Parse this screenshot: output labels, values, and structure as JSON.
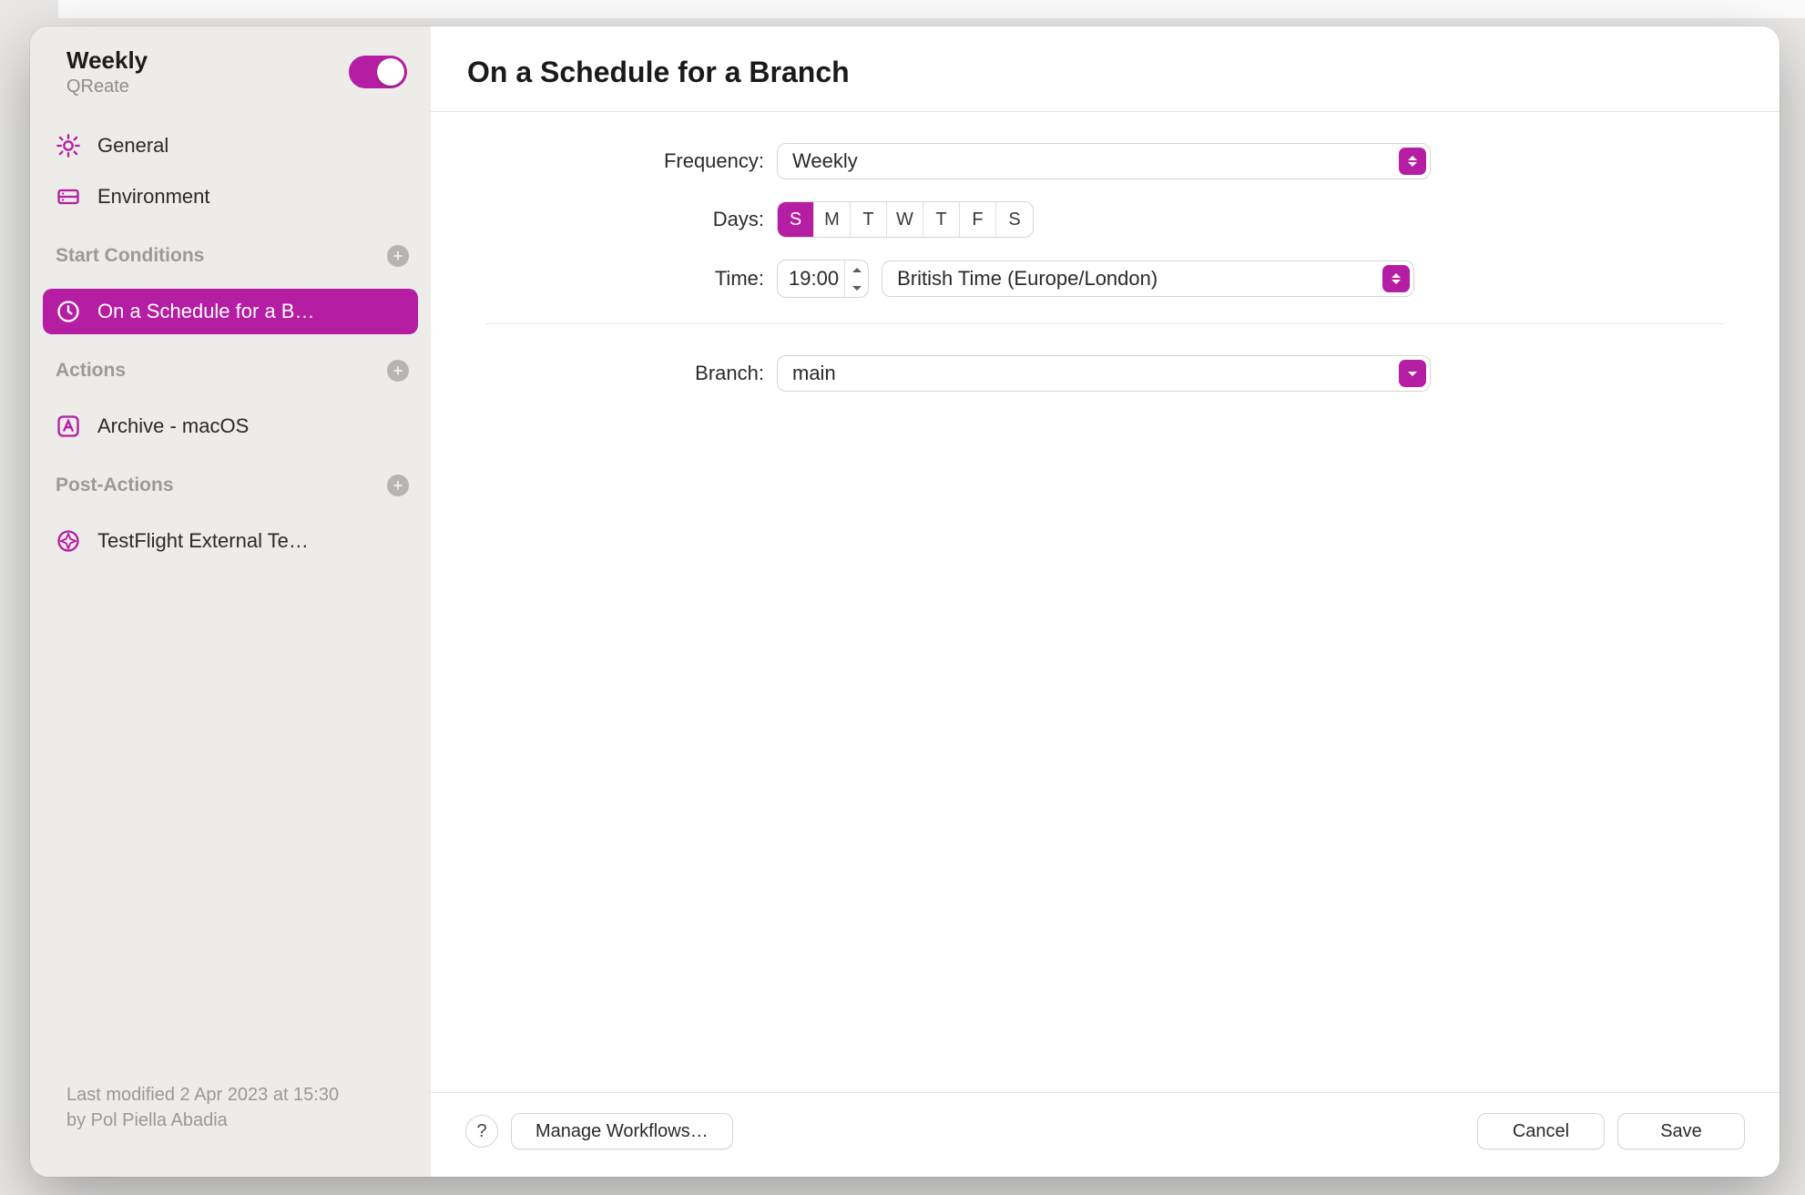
{
  "header": {
    "title": "Weekly",
    "subtitle": "QReate",
    "enabled": true
  },
  "sidebar": {
    "general": {
      "label": "General"
    },
    "environment": {
      "label": "Environment"
    },
    "sections": {
      "start_conditions": {
        "label": "Start Conditions"
      },
      "actions": {
        "label": "Actions"
      },
      "post_actions": {
        "label": "Post-Actions"
      }
    },
    "start_conditions": [
      {
        "label": "On a Schedule for a B…",
        "selected": true
      }
    ],
    "actions": [
      {
        "label": "Archive - macOS"
      }
    ],
    "post_actions": [
      {
        "label": "TestFlight External Te…"
      }
    ],
    "footer": {
      "line1": "Last modified 2 Apr 2023 at 15:30",
      "line2": "by Pol Piella Abadia"
    }
  },
  "main": {
    "title": "On a Schedule for a Branch",
    "labels": {
      "frequency": "Frequency:",
      "days": "Days:",
      "time": "Time:",
      "branch": "Branch:"
    },
    "frequency": "Weekly",
    "days": [
      "S",
      "M",
      "T",
      "W",
      "T",
      "F",
      "S"
    ],
    "days_selected": [
      true,
      false,
      false,
      false,
      false,
      false,
      false
    ],
    "time": "19:00",
    "timezone": "British Time (Europe/London)",
    "branch": "main"
  },
  "footer": {
    "help": "?",
    "manage": "Manage Workflows…",
    "cancel": "Cancel",
    "save": "Save"
  },
  "colors": {
    "accent": "#b51da3"
  }
}
